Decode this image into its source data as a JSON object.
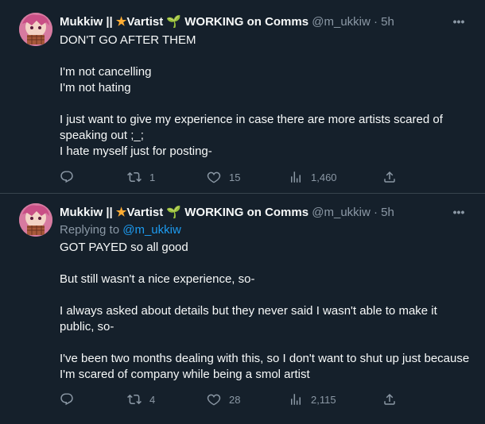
{
  "tweets": [
    {
      "name": "Mukkiw || ",
      "badge_star": "★",
      "name_rest": "Vartist ",
      "badge_sprout": "🌱",
      "name_tail": " WORKING on Comms",
      "handle": "@m_ukkiw",
      "dot": "·",
      "time": "5h",
      "more_icon": "•••",
      "lines": [
        "DON'T GO AFTER THEM",
        "",
        "I'm not cancelling",
        "I'm not hating",
        "",
        "I just want to give my experience in case there are more artists scared of",
        "speaking out ;_;",
        "I hate myself just for posting-"
      ],
      "retweets": "1",
      "likes": "15",
      "views": "1,460"
    },
    {
      "name": "Mukkiw || ",
      "badge_star": "★",
      "name_rest": "Vartist ",
      "badge_sprout": "🌱",
      "name_tail": " WORKING on Comms",
      "handle": "@m_ukkiw",
      "dot": "·",
      "time": "5h",
      "more_icon": "•••",
      "replying_prefix": "Replying to ",
      "replying_to": "@m_ukkiw",
      "lines": [
        "GOT PAYED so all good",
        "",
        "But still wasn't a nice experience, so-",
        "",
        "I always asked about details but they never said I wasn't able to make it",
        "public, so-",
        "",
        "I've been two months dealing with this, so I don't want to shut up just because",
        "I'm scared of company while being a smol artist"
      ],
      "retweets": "4",
      "likes": "28",
      "views": "2,115"
    }
  ]
}
